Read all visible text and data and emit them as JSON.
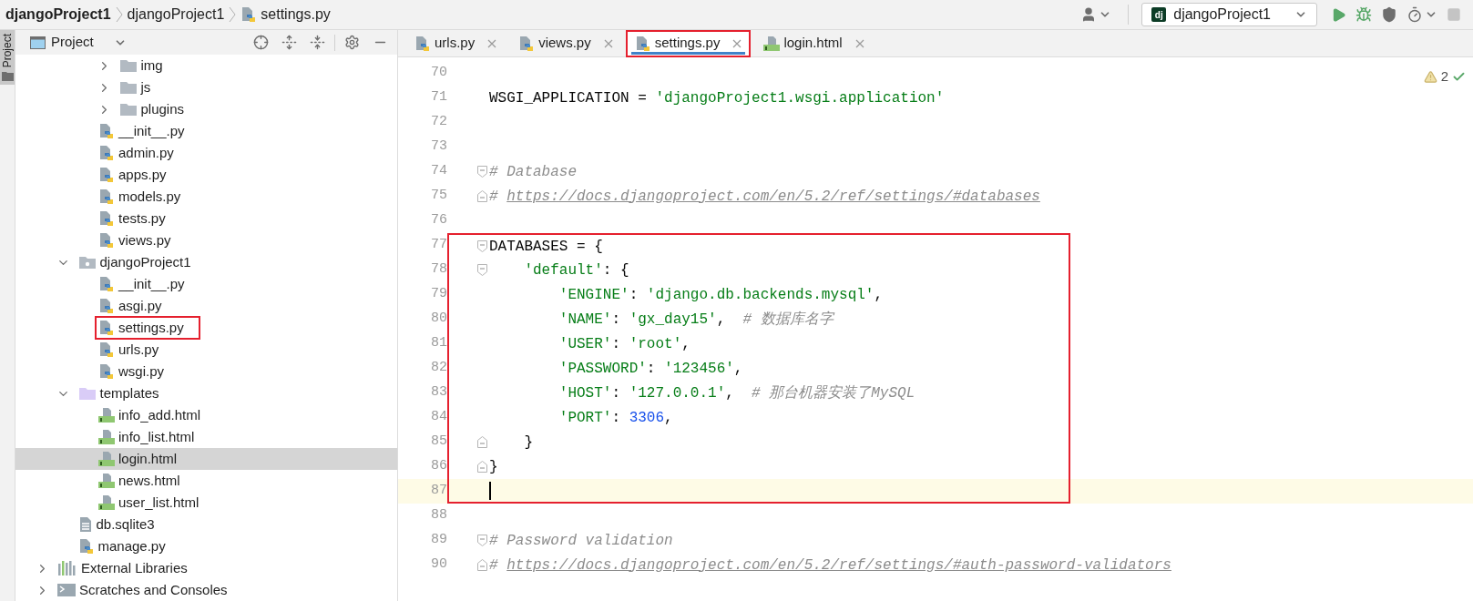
{
  "breadcrumbs": [
    {
      "label": "djangoProject1",
      "kind": "project"
    },
    {
      "label": "djangoProject1",
      "kind": "folder"
    },
    {
      "label": "settings.py",
      "kind": "python"
    }
  ],
  "toolbar": {
    "run_config": {
      "label": "djangoProject1",
      "icon_text": "dj"
    },
    "buttons": [
      {
        "kind": "account",
        "disabled": false
      },
      {
        "kind": "run",
        "disabled": false
      },
      {
        "kind": "debug",
        "disabled": false
      },
      {
        "kind": "coverage",
        "disabled": false
      },
      {
        "kind": "profile",
        "disabled": false
      },
      {
        "kind": "stop",
        "disabled": true
      }
    ]
  },
  "tool_strip": {
    "label": "Project",
    "selected": true
  },
  "project_panel": {
    "title": "Project",
    "tree": [
      {
        "children": [
          {
            "children": [
              {
                "children": [
                  {
                    "label": "img",
                    "kind": "folder",
                    "expanded": false,
                    "selected": false,
                    "highlighted": false
                  },
                  {
                    "label": "js",
                    "kind": "folder",
                    "expanded": false,
                    "selected": false,
                    "highlighted": false
                  },
                  {
                    "label": "plugins",
                    "kind": "folder",
                    "expanded": false,
                    "selected": false,
                    "highlighted": false
                  }
                ]
              },
              {
                "label": "__init__.py",
                "kind": "python",
                "selected": false,
                "highlighted": false
              },
              {
                "label": "admin.py",
                "kind": "python",
                "selected": false,
                "highlighted": false
              },
              {
                "label": "apps.py",
                "kind": "python",
                "selected": false,
                "highlighted": false
              },
              {
                "label": "models.py",
                "kind": "python",
                "selected": false,
                "highlighted": false
              },
              {
                "label": "tests.py",
                "kind": "python",
                "selected": false,
                "highlighted": false
              },
              {
                "label": "views.py",
                "kind": "python",
                "selected": false,
                "highlighted": false
              }
            ]
          },
          {
            "label": "djangoProject1",
            "kind": "package",
            "expanded": true,
            "selected": false,
            "highlighted": false,
            "children": [
              {
                "label": "__init__.py",
                "kind": "python",
                "selected": false,
                "highlighted": false
              },
              {
                "label": "asgi.py",
                "kind": "python",
                "selected": false,
                "highlighted": false
              },
              {
                "label": "settings.py",
                "kind": "python",
                "selected": false,
                "highlighted": true
              },
              {
                "label": "urls.py",
                "kind": "python",
                "selected": false,
                "highlighted": false
              },
              {
                "label": "wsgi.py",
                "kind": "python",
                "selected": false,
                "highlighted": false
              }
            ]
          },
          {
            "label": "templates",
            "kind": "templates",
            "expanded": true,
            "selected": false,
            "highlighted": false,
            "children": [
              {
                "label": "info_add.html",
                "kind": "html",
                "selected": false,
                "highlighted": false
              },
              {
                "label": "info_list.html",
                "kind": "html",
                "selected": false,
                "highlighted": false
              },
              {
                "label": "login.html",
                "kind": "html",
                "selected": true,
                "highlighted": false
              },
              {
                "label": "news.html",
                "kind": "html",
                "selected": false,
                "highlighted": false
              },
              {
                "label": "user_list.html",
                "kind": "html",
                "selected": false,
                "highlighted": false
              }
            ]
          },
          {
            "label": "db.sqlite3",
            "kind": "text",
            "selected": false,
            "highlighted": false
          },
          {
            "label": "manage.py",
            "kind": "python",
            "selected": false,
            "highlighted": false
          }
        ]
      },
      {
        "label": "External Libraries",
        "kind": "library",
        "expanded": false,
        "selected": false,
        "highlighted": false
      },
      {
        "label": "Scratches and Consoles",
        "kind": "scratches",
        "expanded": false,
        "selected": false,
        "highlighted": false
      }
    ]
  },
  "tabs": [
    {
      "label": "urls.py",
      "kind": "python",
      "selected": false,
      "highlighted": false
    },
    {
      "label": "views.py",
      "kind": "python",
      "selected": false,
      "highlighted": false
    },
    {
      "label": "settings.py",
      "kind": "python",
      "selected": true,
      "highlighted": true
    },
    {
      "label": "login.html",
      "kind": "html",
      "selected": false,
      "highlighted": false
    }
  ],
  "editor": {
    "warnings": "2",
    "lines": [
      {
        "number": "70",
        "current": false,
        "highlighted": false,
        "fold_start": false,
        "fold_end": false
      },
      {
        "number": "71",
        "current": false,
        "highlighted": false,
        "fold_start": false,
        "fold_end": false,
        "tokens": [
          {
            "kind": "plain",
            "text": "WSGI_APPLICATION = "
          },
          {
            "kind": "string",
            "text": "'djangoProject1.wsgi.application'"
          }
        ]
      },
      {
        "number": "72",
        "current": false,
        "highlighted": false,
        "fold_start": false,
        "fold_end": false
      },
      {
        "number": "73",
        "current": false,
        "highlighted": false,
        "fold_start": false,
        "fold_end": false
      },
      {
        "number": "74",
        "current": false,
        "highlighted": false,
        "fold_start": true,
        "fold_end": false,
        "tokens": [
          {
            "kind": "comment",
            "text": "# Database"
          }
        ]
      },
      {
        "number": "75",
        "current": false,
        "highlighted": false,
        "fold_start": false,
        "fold_end": true,
        "tokens": [
          {
            "kind": "comment",
            "text": "# "
          },
          {
            "kind": "link",
            "text": "https://docs.djangoproject.com/en/5.2/ref/settings/#databases"
          }
        ]
      },
      {
        "number": "76",
        "current": false,
        "highlighted": false,
        "fold_start": false,
        "fold_end": false
      },
      {
        "number": "77",
        "current": false,
        "highlighted": true,
        "fold_start": true,
        "fold_end": false,
        "tokens": [
          {
            "kind": "plain",
            "text": "DATABASES = {"
          }
        ]
      },
      {
        "number": "78",
        "current": false,
        "highlighted": true,
        "fold_start": true,
        "fold_end": false,
        "tokens": [
          {
            "kind": "string",
            "text": "    'default'"
          },
          {
            "kind": "plain",
            "text": ": {"
          }
        ]
      },
      {
        "number": "79",
        "current": false,
        "highlighted": true,
        "fold_start": false,
        "fold_end": false,
        "tokens": [
          {
            "kind": "string",
            "text": "        'ENGINE'"
          },
          {
            "kind": "plain",
            "text": ": "
          },
          {
            "kind": "string",
            "text": "'django.db.backends.mysql'"
          },
          {
            "kind": "plain",
            "text": ","
          }
        ]
      },
      {
        "number": "80",
        "current": false,
        "highlighted": true,
        "fold_start": false,
        "fold_end": false,
        "tokens": [
          {
            "kind": "string",
            "text": "        'NAME'"
          },
          {
            "kind": "plain",
            "text": ": "
          },
          {
            "kind": "string",
            "text": "'gx_day15'"
          },
          {
            "kind": "plain",
            "text": ",  "
          },
          {
            "kind": "comment",
            "text": "# 数据库名字"
          }
        ]
      },
      {
        "number": "81",
        "current": false,
        "highlighted": true,
        "fold_start": false,
        "fold_end": false,
        "tokens": [
          {
            "kind": "string",
            "text": "        'USER'"
          },
          {
            "kind": "plain",
            "text": ": "
          },
          {
            "kind": "string",
            "text": "'root'"
          },
          {
            "kind": "plain",
            "text": ","
          }
        ]
      },
      {
        "number": "82",
        "current": false,
        "highlighted": true,
        "fold_start": false,
        "fold_end": false,
        "tokens": [
          {
            "kind": "string",
            "text": "        'PASSWORD'"
          },
          {
            "kind": "plain",
            "text": ": "
          },
          {
            "kind": "string",
            "text": "'123456'"
          },
          {
            "kind": "plain",
            "text": ","
          }
        ]
      },
      {
        "number": "83",
        "current": false,
        "highlighted": true,
        "fold_start": false,
        "fold_end": false,
        "tokens": [
          {
            "kind": "string",
            "text": "        'HOST'"
          },
          {
            "kind": "plain",
            "text": ": "
          },
          {
            "kind": "string",
            "text": "'127.0.0.1'"
          },
          {
            "kind": "plain",
            "text": ",  "
          },
          {
            "kind": "comment",
            "text": "# 那台机器安装了MySQL"
          }
        ]
      },
      {
        "number": "84",
        "current": false,
        "highlighted": true,
        "fold_start": false,
        "fold_end": false,
        "tokens": [
          {
            "kind": "string",
            "text": "        'PORT'"
          },
          {
            "kind": "plain",
            "text": ": "
          },
          {
            "kind": "number",
            "text": "3306"
          },
          {
            "kind": "plain",
            "text": ","
          }
        ]
      },
      {
        "number": "85",
        "current": false,
        "highlighted": true,
        "fold_start": false,
        "fold_end": true,
        "tokens": [
          {
            "kind": "plain",
            "text": "    }"
          }
        ]
      },
      {
        "number": "86",
        "current": false,
        "highlighted": true,
        "fold_start": false,
        "fold_end": true,
        "tokens": [
          {
            "kind": "plain",
            "text": "}"
          }
        ]
      },
      {
        "number": "87",
        "current": true,
        "highlighted": true,
        "fold_start": false,
        "fold_end": false
      },
      {
        "number": "88",
        "current": false,
        "highlighted": false,
        "fold_start": false,
        "fold_end": false
      },
      {
        "number": "89",
        "current": false,
        "highlighted": false,
        "fold_start": true,
        "fold_end": false,
        "tokens": [
          {
            "kind": "comment",
            "text": "# Password validation"
          }
        ]
      },
      {
        "number": "90",
        "current": false,
        "highlighted": false,
        "fold_start": false,
        "fold_end": true,
        "tokens": [
          {
            "kind": "comment",
            "text": "# "
          },
          {
            "kind": "link",
            "text": "https://docs.djangoproject.com/en/5.2/ref/settings/#auth-password-validators"
          }
        ]
      }
    ]
  }
}
